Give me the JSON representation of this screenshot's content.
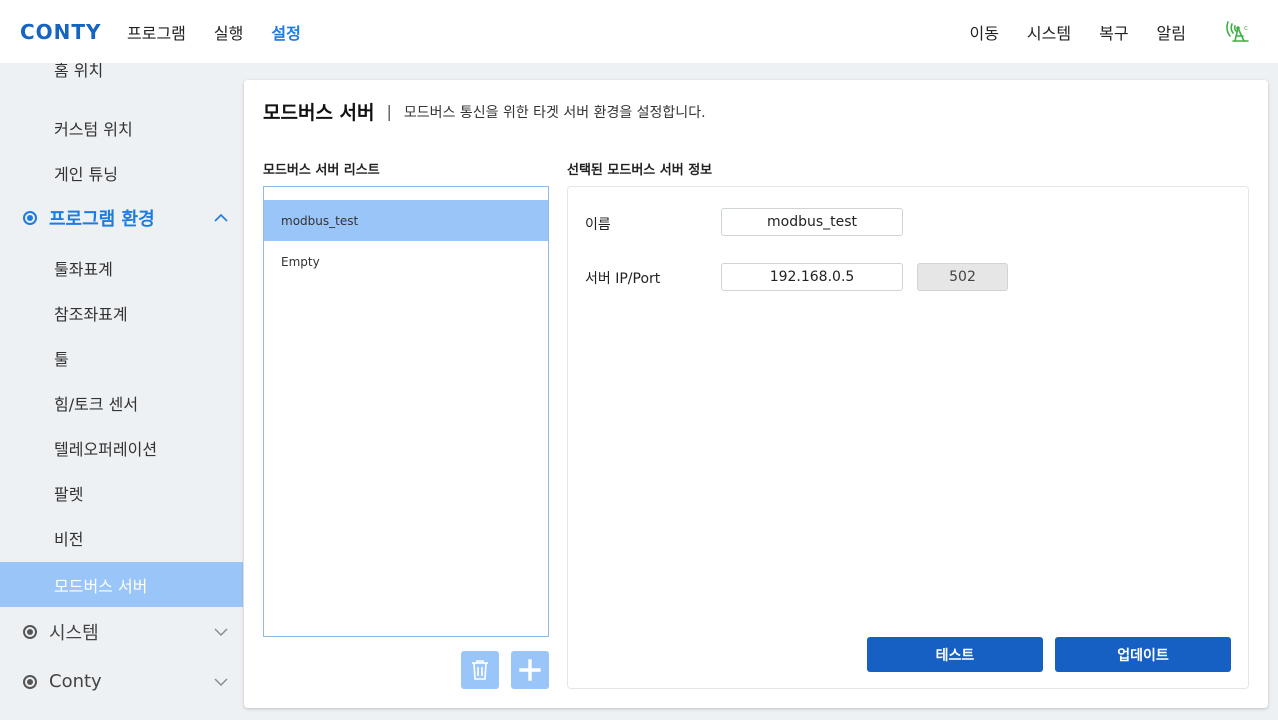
{
  "header": {
    "logo": "CONTY",
    "nav_left": [
      "프로그램",
      "실행",
      "설정"
    ],
    "active_nav": "설정",
    "nav_right": [
      "이동",
      "시스템",
      "복구",
      "알림"
    ],
    "status_icon": "wifi-signal-icon",
    "accent_color": "#1e7be0",
    "status_color": "#3cb043"
  },
  "sidebar": {
    "cut_item": "홈 위치",
    "items_top": [
      "커스텀 위치",
      "게인 튜닝"
    ],
    "group_open": "프로그램 환경",
    "group_items": [
      "툴좌표계",
      "참조좌표계",
      "툴",
      "힘/토크 센서",
      "텔레오퍼레이션",
      "팔렛",
      "비전",
      "모드버스 서버"
    ],
    "selected_item": "모드버스 서버",
    "groups_closed": [
      "시스템",
      "Conty"
    ]
  },
  "main": {
    "title": "모드버스 서버",
    "separator": "|",
    "description": "모드버스 통신을 위한 타겟 서버 환경을 설정합니다.",
    "list_label": "모드버스 서버 리스트",
    "list_items": [
      "modbus_test",
      "Empty"
    ],
    "info_label": "선택된 모드버스 서버 정보",
    "name_label": "이름",
    "name_value": "modbus_test",
    "ip_label": "서버 IP/Port",
    "ip_value": "192.168.0.5",
    "port_value": "502",
    "test_button": "테스트",
    "update_button": "업데이트",
    "delete_icon": "trash-icon",
    "add_icon": "plus-icon"
  }
}
